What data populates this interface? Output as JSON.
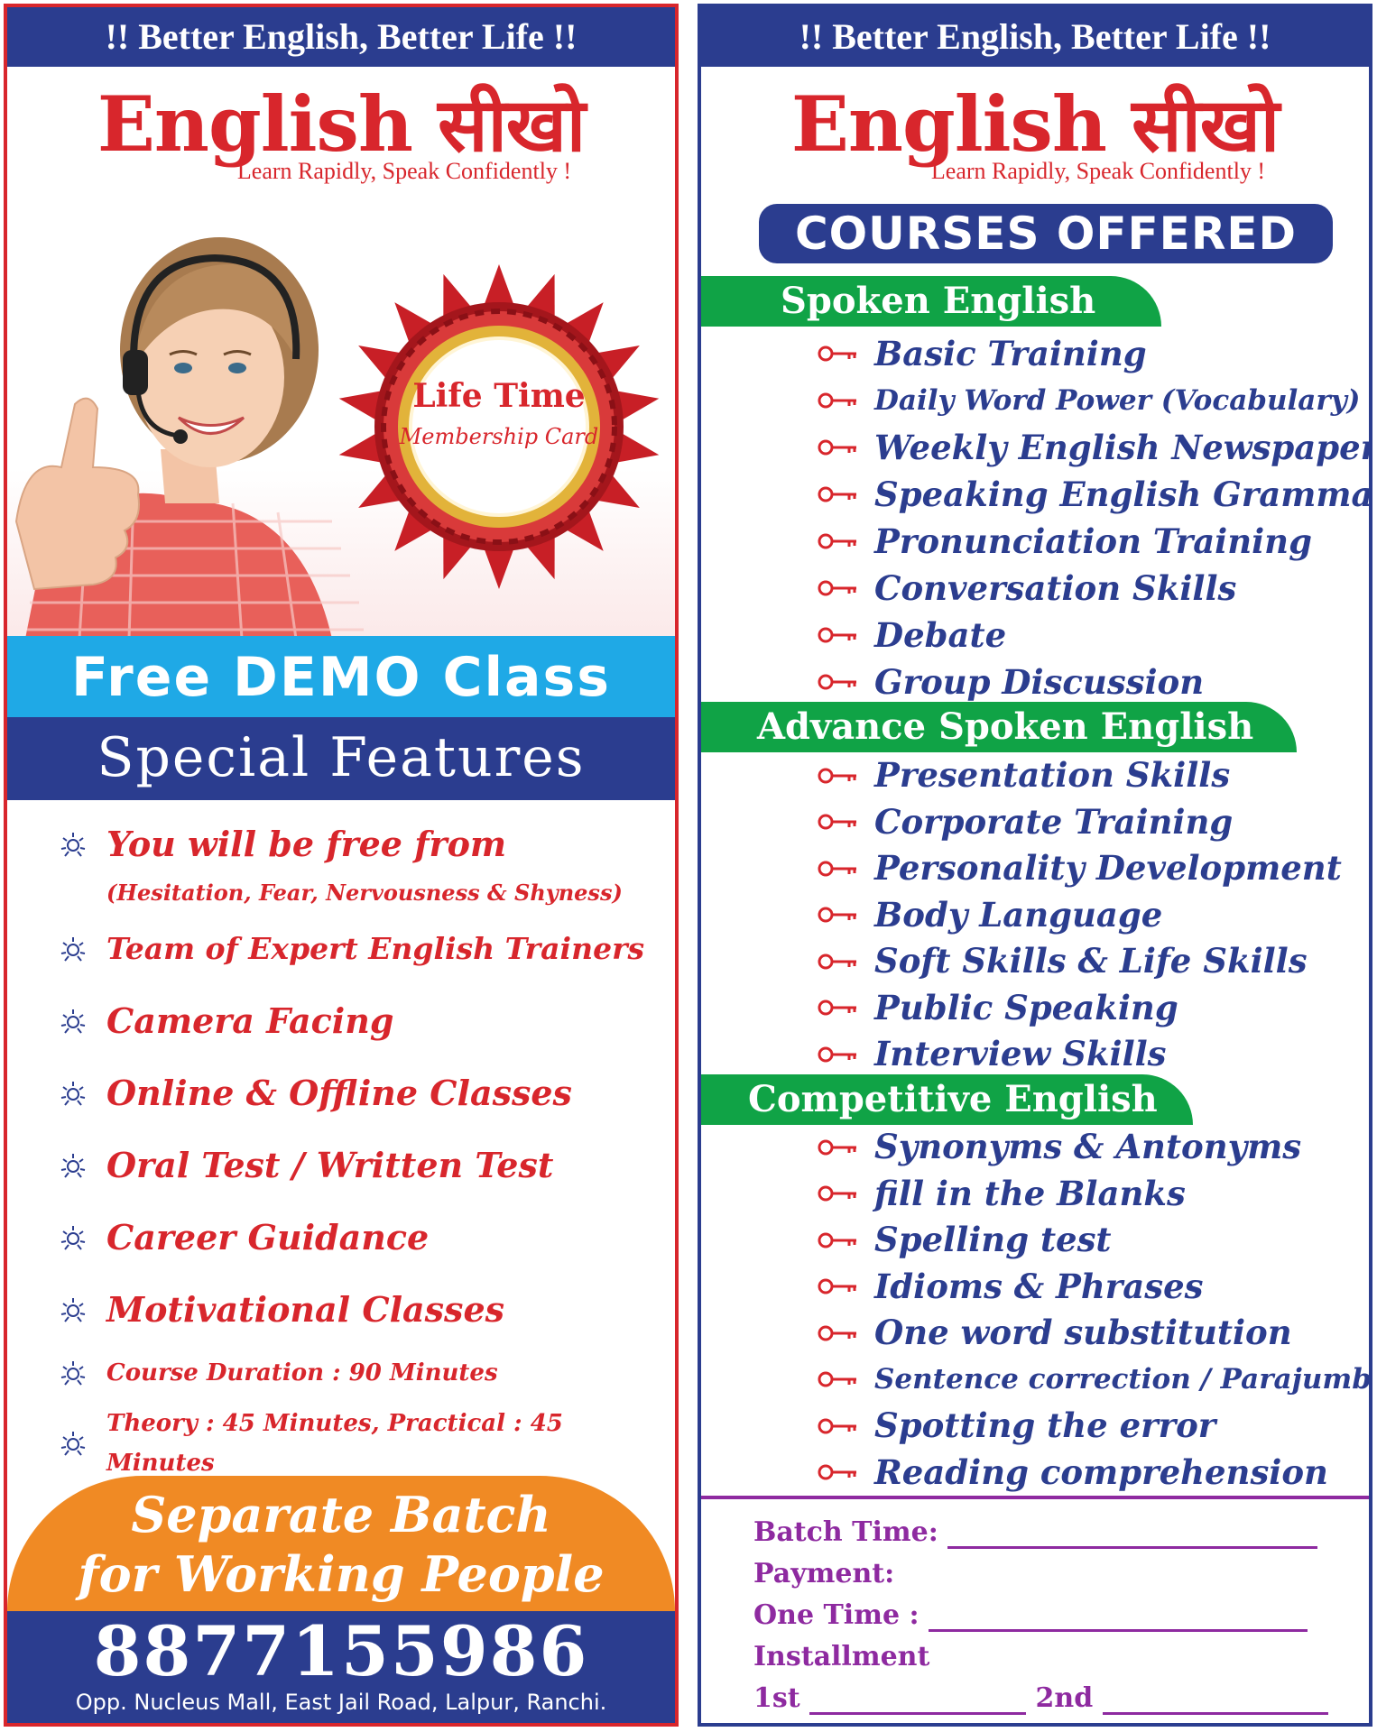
{
  "left": {
    "top_banner": "!! Better English, Better Life !!",
    "brand_english": "English",
    "brand_hindi": "सीखो",
    "tagline": "Learn Rapidly, Speak Confidently !",
    "badge_line1": "Life Time",
    "badge_line2": "Membership Card",
    "demo": "Free DEMO Class",
    "special": "Special Features",
    "features": [
      {
        "text": "You will be free from",
        "size": "big"
      },
      {
        "text": "(Hesitation, Fear, Nervousness & Shyness)",
        "size": "sub"
      },
      {
        "text": "Team of Expert English Trainers",
        "size": "mid"
      },
      {
        "text": "Camera Facing",
        "size": "big"
      },
      {
        "text": "Online & Offline Classes",
        "size": "big"
      },
      {
        "text": "Oral Test / Written Test",
        "size": "big"
      },
      {
        "text": "Career Guidance",
        "size": "big"
      },
      {
        "text": "Motivational Classes",
        "size": "big"
      },
      {
        "text": "Course Duration : 90 Minutes",
        "size": "small"
      },
      {
        "text": "Theory : 45 Minutes, Practical : 45 Minutes",
        "size": "small"
      }
    ],
    "batch_line1": "Separate Batch",
    "batch_line2": "for Working People",
    "phone": "8877155986",
    "address": "Opp. Nucleus Mall, East Jail Road, Lalpur, Ranchi."
  },
  "right": {
    "top_banner": "!! Better English, Better Life !!",
    "brand_english": "English",
    "brand_hindi": "सीखो",
    "tagline": "Learn Rapidly, Speak Confidently !",
    "courses_title": "COURSES OFFERED",
    "categories": [
      {
        "title": "Spoken English",
        "items": [
          "Basic Training",
          "Daily Word Power (Vocabulary)",
          "Weekly English Newspaper",
          "Speaking English Grammar",
          "Pronunciation Training",
          "Conversation Skills",
          "Debate",
          "Group Discussion"
        ]
      },
      {
        "title": "Advance Spoken English",
        "items": [
          "Presentation Skills",
          "Corporate Training",
          "Personality Development",
          "Body Language",
          "Soft Skills & Life Skills",
          "Public Speaking",
          "Interview Skills"
        ]
      },
      {
        "title": "Competitive English",
        "items": [
          "Synonyms & Antonyms",
          "fill in the Blanks",
          "Spelling test",
          "Idioms & Phrases",
          "One word substitution",
          "Sentence correction / Parajumbles",
          "Spotting the error",
          "Reading comprehension"
        ]
      }
    ],
    "form": {
      "batch_time": "Batch Time:",
      "payment": "Payment:",
      "one_time": "One Time :",
      "installment": "Installment",
      "first": "1st",
      "second": "2nd"
    }
  },
  "colors": {
    "red": "#d8262c",
    "navy": "#2b3d8f",
    "sky": "#1fa9e6",
    "green": "#10a346",
    "orange": "#f08a24",
    "purple": "#8e2aa0"
  }
}
